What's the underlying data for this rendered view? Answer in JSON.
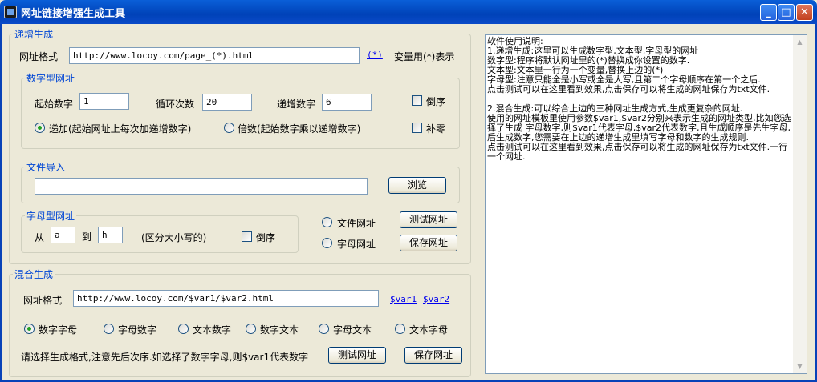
{
  "window": {
    "title": "网址链接增强生成工具",
    "minimize": "_",
    "maximize": "□",
    "close": "✕"
  },
  "increment": {
    "group_label": "递增生成",
    "url_label": "网址格式",
    "url_value": "http://www.locoy.com/page_(*).html",
    "var_link": "(*)",
    "var_hint": "变量用(*)表示",
    "numeric": {
      "group_label": "数字型网址",
      "start_label": "起始数字",
      "start_value": "1",
      "loop_label": "循环次数",
      "loop_value": "20",
      "step_label": "递增数字",
      "step_value": "6",
      "reverse_label": "倒序",
      "pad_label": "补零",
      "add_label": "递加(起始网址上每次加递增数字)",
      "multiply_label": "倍数(起始数字乘以递增数字)",
      "mode_selected": "add"
    },
    "file_import": {
      "group_label": "文件导入",
      "path_value": "",
      "browse_label": "浏览"
    },
    "alpha": {
      "group_label": "字母型网址",
      "from_label": "从",
      "from_value": "a",
      "to_label": "到",
      "to_value": "h",
      "case_hint": "(区分大小写的)",
      "reverse_label": "倒序"
    },
    "source": {
      "file_label": "文件网址",
      "alpha_label": "字母网址"
    },
    "test_label": "测试网址",
    "save_label": "保存网址"
  },
  "mixed": {
    "group_label": "混合生成",
    "url_label": "网址格式",
    "url_value": "http://www.locoy.com/$var1/$var2.html",
    "var1_link": "$var1",
    "var2_link": "$var2",
    "options": [
      "数字字母",
      "字母数字",
      "文本数字",
      "数字文本",
      "字母文本",
      "文本字母"
    ],
    "selected_index": 0,
    "hint": "请选择生成格式,注意先后次序.如选择了数字字母,则$var1代表数字",
    "test_label": "测试网址",
    "save_label": "保存网址"
  },
  "help_text": "软件使用说明:\n1.递增生成:这里可以生成数字型,文本型,字母型的网址\n数字型:程序将默认网址里的(*)替换成你设置的数字.\n文本型:文本里一行为一个变量,替换上边的(*)\n字母型:注意只能全是小写或全是大写,且第二个字母顺序在第一个之后.\n点击测试可以在这里看到效果,点击保存可以将生成的网址保存为txt文件.\n\n2.混合生成:可以综合上边的三种网址生成方式,生成更复杂的网址.\n使用的网址模板里使用参数$var1,$var2分别来表示生成的网址类型,比如您选择了生成 字母数字,则$var1代表字母,$var2代表数字,且生成顺序是先生字母,后生成数字,您需要在上边的递增生成里填写字母和数字的生成规则.\n点击测试可以在这里看到效果,点击保存可以将生成的网址保存为txt文件.一行一个网址.",
  "scrollbar": {
    "up": "▲",
    "down": "▼"
  },
  "colors": {
    "titlebar": "#0842b8",
    "group_label": "#0046d5",
    "radio_selected": "#21a121"
  }
}
